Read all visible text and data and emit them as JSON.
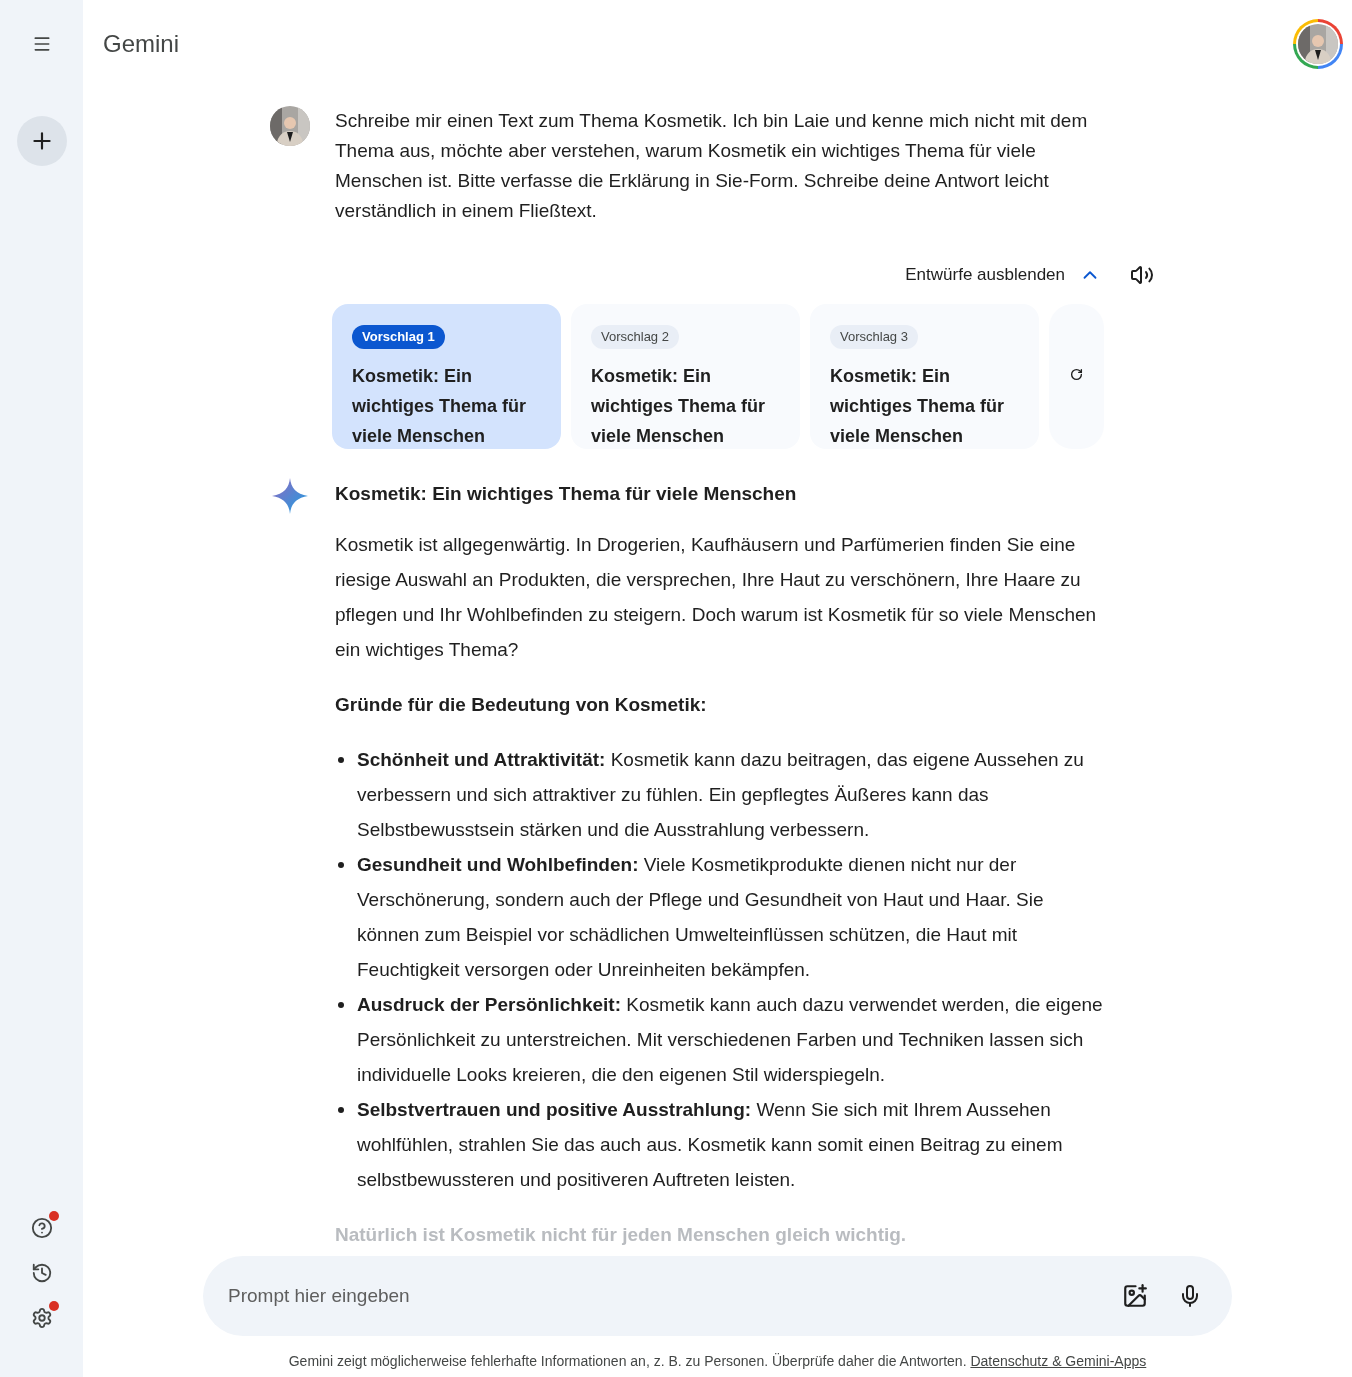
{
  "sidebar": {
    "items": [
      {
        "kind": "help",
        "notification": true
      },
      {
        "kind": "history",
        "notification": false
      },
      {
        "kind": "settings",
        "notification": true
      }
    ]
  },
  "header": {
    "title": "Gemini"
  },
  "prompt": {
    "text": "Schreibe mir einen Text zum Thema Kosmetik. Ich bin Laie und kenne mich nicht mit dem Thema aus, möchte aber verstehen, warum Kosmetik ein wichtiges Thema für viele Menschen ist. Bitte verfasse die Erklärung in Sie-Form. Schreibe deine Antwort leicht verständlich in einem Fließtext."
  },
  "drafts": {
    "toggle_label": "Entwürfe ausblenden",
    "expanded": true,
    "items": [
      {
        "label": "Vorschlag 1",
        "title": "Kosmetik: Ein wichtiges Thema für viele Menschen",
        "selected": true
      },
      {
        "label": "Vorschlag 2",
        "title": "Kosmetik: Ein wichtiges Thema für viele Menschen",
        "selected": false
      },
      {
        "label": "Vorschlag 3",
        "title": "Kosmetik: Ein wichtiges Thema für viele Menschen",
        "selected": false
      }
    ]
  },
  "response": {
    "title": "Kosmetik: Ein wichtiges Thema für viele Menschen",
    "intro": "Kosmetik ist allgegenwärtig. In Drogerien, Kaufhäusern und Parfümerien finden Sie eine riesige Auswahl an Produkten, die versprechen, Ihre Haut zu verschönern, Ihre Haare zu pflegen und Ihr Wohlbefinden zu steigern. Doch warum ist Kosmetik für so viele Menschen ein wichtiges Thema?",
    "heading": "Gründe für die Bedeutung von Kosmetik:",
    "bullets": [
      "**Schönheit und Attraktivität:** Kosmetik kann dazu beitragen, das eigene Aussehen zu verbessern und sich attraktiver zu fühlen. Ein gepflegtes Äußeres kann das Selbstbewusstsein stärken und die Ausstrahlung verbessern.",
      "**Gesundheit und Wohlbefinden:** Viele Kosmetikprodukte dienen nicht nur der Verschönerung, sondern auch der Pflege und Gesundheit von Haut und Haar. Sie können zum Beispiel vor schädlichen Umwelteinflüssen schützen, die Haut mit Feuchtigkeit versorgen oder Unreinheiten bekämpfen.",
      "**Ausdruck der Persönlichkeit:** Kosmetik kann auch dazu verwendet werden, die eigene Persönlichkeit zu unterstreichen. Mit verschiedenen Farben und Techniken lassen sich individuelle Looks kreieren, die den eigenen Stil widerspiegeln.",
      "**Selbstvertrauen und positive Ausstrahlung:** Wenn Sie sich mit Ihrem Aussehen wohlfühlen, strahlen Sie das auch aus. Kosmetik kann somit einen Beitrag zu einem selbstbewussteren und positiveren Auftreten leisten."
    ],
    "faded_text": "Natürlich ist Kosmetik nicht für jeden Menschen gleich wichtig."
  },
  "input": {
    "placeholder": "Prompt hier eingeben"
  },
  "footer": {
    "text": "Gemini zeigt möglicherweise fehlerhafte Informationen an, z. B. zu Personen. Überprüfe daher die Antworten.",
    "link": "Datenschutz & Gemini-Apps"
  }
}
